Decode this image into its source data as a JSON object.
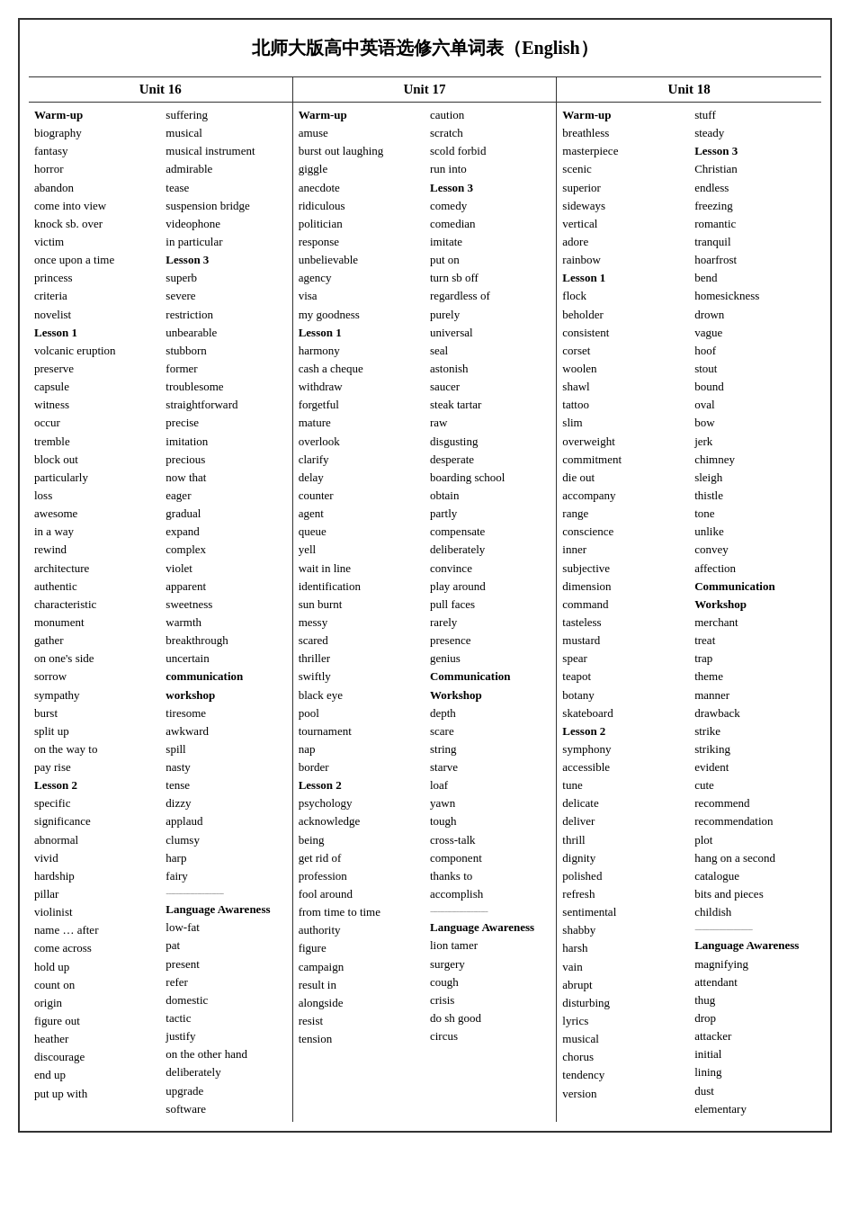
{
  "title": "北师大版高中英语选修六单词表（English）",
  "unit16_header": "Unit 16",
  "unit17_header": "Unit 17",
  "unit18_header": "Unit 18",
  "unit16_col1": [
    {
      "text": "Warm-up",
      "bold": true
    },
    {
      "text": "biography"
    },
    {
      "text": "fantasy"
    },
    {
      "text": "horror"
    },
    {
      "text": "abandon"
    },
    {
      "text": "come into view"
    },
    {
      "text": "knock sb. over"
    },
    {
      "text": "victim"
    },
    {
      "text": "once upon a time"
    },
    {
      "text": "princess"
    },
    {
      "text": "criteria"
    },
    {
      "text": "novelist"
    },
    {
      "text": "Lesson 1",
      "bold": true
    },
    {
      "text": "volcanic eruption"
    },
    {
      "text": "preserve"
    },
    {
      "text": "capsule"
    },
    {
      "text": "witness"
    },
    {
      "text": "occur"
    },
    {
      "text": "tremble"
    },
    {
      "text": "block out"
    },
    {
      "text": "particularly"
    },
    {
      "text": "loss"
    },
    {
      "text": "awesome"
    },
    {
      "text": "in a way"
    },
    {
      "text": "rewind"
    },
    {
      "text": "architecture"
    },
    {
      "text": "authentic"
    },
    {
      "text": "characteristic"
    },
    {
      "text": "monument"
    },
    {
      "text": "gather"
    },
    {
      "text": "on one's side"
    },
    {
      "text": "sorrow"
    },
    {
      "text": "sympathy"
    },
    {
      "text": "burst"
    },
    {
      "text": "split up"
    },
    {
      "text": "on the way to"
    },
    {
      "text": "pay rise"
    },
    {
      "text": "Lesson 2",
      "bold": true
    },
    {
      "text": "specific"
    },
    {
      "text": "significance"
    },
    {
      "text": "abnormal"
    },
    {
      "text": "vivid"
    },
    {
      "text": "hardship"
    },
    {
      "text": "pillar"
    },
    {
      "text": "violinist"
    },
    {
      "text": "name … after"
    },
    {
      "text": "come across"
    },
    {
      "text": "hold up"
    },
    {
      "text": "count on"
    },
    {
      "text": "origin"
    },
    {
      "text": "figure out"
    },
    {
      "text": "heather"
    },
    {
      "text": "discourage"
    },
    {
      "text": "end up"
    },
    {
      "text": "put up with"
    }
  ],
  "unit16_col2": [
    {
      "text": "suffering"
    },
    {
      "text": "musical"
    },
    {
      "text": "musical instrument"
    },
    {
      "text": "admirable"
    },
    {
      "text": "tease"
    },
    {
      "text": "suspension bridge"
    },
    {
      "text": "videophone"
    },
    {
      "text": "in particular"
    },
    {
      "text": "Lesson 3",
      "bold": true
    },
    {
      "text": "superb"
    },
    {
      "text": "severe"
    },
    {
      "text": "restriction"
    },
    {
      "text": "unbearable"
    },
    {
      "text": "stubborn"
    },
    {
      "text": "former"
    },
    {
      "text": "troublesome"
    },
    {
      "text": "straightforward"
    },
    {
      "text": "precise"
    },
    {
      "text": "imitation"
    },
    {
      "text": "precious"
    },
    {
      "text": "now that"
    },
    {
      "text": "eager"
    },
    {
      "text": "gradual"
    },
    {
      "text": "expand"
    },
    {
      "text": "complex"
    },
    {
      "text": "violet"
    },
    {
      "text": "apparent"
    },
    {
      "text": "sweetness"
    },
    {
      "text": "warmth"
    },
    {
      "text": "breakthrough"
    },
    {
      "text": "uncertain"
    },
    {
      "text": "communication",
      "bold": true
    },
    {
      "text": "workshop",
      "bold": true
    },
    {
      "text": "tiresome"
    },
    {
      "text": "awkward"
    },
    {
      "text": "spill"
    },
    {
      "text": "nasty"
    },
    {
      "text": "tense"
    },
    {
      "text": "dizzy"
    },
    {
      "text": "applaud"
    },
    {
      "text": "clumsy"
    },
    {
      "text": "harp"
    },
    {
      "text": "fairy"
    },
    {
      "text": "------------------------",
      "sep": true
    },
    {
      "text": "Language Awareness",
      "bold": true
    },
    {
      "text": "low-fat"
    },
    {
      "text": "pat"
    },
    {
      "text": "present"
    },
    {
      "text": "refer"
    },
    {
      "text": "domestic"
    },
    {
      "text": "tactic"
    },
    {
      "text": "justify"
    },
    {
      "text": "on the other hand"
    },
    {
      "text": "deliberately"
    },
    {
      "text": "upgrade"
    },
    {
      "text": "software"
    }
  ],
  "unit17_col1": [
    {
      "text": "Warm-up",
      "bold": true
    },
    {
      "text": "amuse"
    },
    {
      "text": "burst out laughing"
    },
    {
      "text": "giggle"
    },
    {
      "text": "anecdote"
    },
    {
      "text": "ridiculous"
    },
    {
      "text": "politician"
    },
    {
      "text": "response"
    },
    {
      "text": "unbelievable"
    },
    {
      "text": "agency"
    },
    {
      "text": "visa"
    },
    {
      "text": "my goodness"
    },
    {
      "text": "Lesson 1",
      "bold": true
    },
    {
      "text": "harmony"
    },
    {
      "text": "cash a cheque"
    },
    {
      "text": "withdraw"
    },
    {
      "text": "forgetful"
    },
    {
      "text": "mature"
    },
    {
      "text": "overlook"
    },
    {
      "text": "clarify"
    },
    {
      "text": "delay"
    },
    {
      "text": "counter"
    },
    {
      "text": "agent"
    },
    {
      "text": "queue"
    },
    {
      "text": "yell"
    },
    {
      "text": "wait in line"
    },
    {
      "text": "identification"
    },
    {
      "text": "sun burnt"
    },
    {
      "text": "messy"
    },
    {
      "text": "scared"
    },
    {
      "text": "thriller"
    },
    {
      "text": "swiftly"
    },
    {
      "text": "black eye"
    },
    {
      "text": "pool"
    },
    {
      "text": "tournament"
    },
    {
      "text": "nap"
    },
    {
      "text": "border"
    },
    {
      "text": "Lesson 2",
      "bold": true
    },
    {
      "text": "psychology"
    },
    {
      "text": "acknowledge"
    },
    {
      "text": "being"
    },
    {
      "text": "get rid of"
    },
    {
      "text": "profession"
    },
    {
      "text": "fool around"
    },
    {
      "text": "from time to time"
    },
    {
      "text": "authority"
    },
    {
      "text": "figure"
    },
    {
      "text": "campaign"
    },
    {
      "text": "result in"
    },
    {
      "text": "alongside"
    },
    {
      "text": "resist"
    },
    {
      "text": "tension"
    }
  ],
  "unit17_col2": [
    {
      "text": "caution"
    },
    {
      "text": "scratch"
    },
    {
      "text": "scold forbid"
    },
    {
      "text": "run into"
    },
    {
      "text": "Lesson 3",
      "bold": true
    },
    {
      "text": "comedy"
    },
    {
      "text": "comedian"
    },
    {
      "text": "imitate"
    },
    {
      "text": "put on"
    },
    {
      "text": "turn sb off"
    },
    {
      "text": "regardless of"
    },
    {
      "text": "purely"
    },
    {
      "text": "universal"
    },
    {
      "text": "seal"
    },
    {
      "text": "astonish"
    },
    {
      "text": "saucer"
    },
    {
      "text": "steak tartar"
    },
    {
      "text": "raw"
    },
    {
      "text": "disgusting"
    },
    {
      "text": "desperate"
    },
    {
      "text": "boarding school"
    },
    {
      "text": "obtain"
    },
    {
      "text": "partly"
    },
    {
      "text": "compensate"
    },
    {
      "text": "deliberately"
    },
    {
      "text": "convince"
    },
    {
      "text": "play around"
    },
    {
      "text": "pull faces"
    },
    {
      "text": "rarely"
    },
    {
      "text": "presence"
    },
    {
      "text": "genius"
    },
    {
      "text": "Communication",
      "bold": true
    },
    {
      "text": "Workshop",
      "bold": true
    },
    {
      "text": "depth"
    },
    {
      "text": "scare"
    },
    {
      "text": "string"
    },
    {
      "text": "starve"
    },
    {
      "text": "loaf"
    },
    {
      "text": "yawn"
    },
    {
      "text": "tough"
    },
    {
      "text": "cross-talk"
    },
    {
      "text": "component"
    },
    {
      "text": "thanks to"
    },
    {
      "text": "accomplish"
    },
    {
      "text": "------------------------",
      "sep": true
    },
    {
      "text": "Language Awareness",
      "bold": true
    },
    {
      "text": "lion tamer"
    },
    {
      "text": "surgery"
    },
    {
      "text": "cough"
    },
    {
      "text": "crisis"
    },
    {
      "text": "do sh good"
    },
    {
      "text": "circus"
    }
  ],
  "unit18_col1": [
    {
      "text": "Warm-up",
      "bold": true
    },
    {
      "text": "breathless"
    },
    {
      "text": "masterpiece"
    },
    {
      "text": "scenic"
    },
    {
      "text": "superior"
    },
    {
      "text": "sideways"
    },
    {
      "text": "vertical"
    },
    {
      "text": "adore"
    },
    {
      "text": "rainbow"
    },
    {
      "text": "Lesson 1",
      "bold": true
    },
    {
      "text": "flock"
    },
    {
      "text": "beholder"
    },
    {
      "text": "consistent"
    },
    {
      "text": "corset"
    },
    {
      "text": "woolen"
    },
    {
      "text": "shawl"
    },
    {
      "text": "tattoo"
    },
    {
      "text": "slim"
    },
    {
      "text": "overweight"
    },
    {
      "text": "commitment"
    },
    {
      "text": "die out"
    },
    {
      "text": "accompany"
    },
    {
      "text": "range"
    },
    {
      "text": "conscience"
    },
    {
      "text": "inner"
    },
    {
      "text": "subjective"
    },
    {
      "text": "dimension"
    },
    {
      "text": "command"
    },
    {
      "text": "tasteless"
    },
    {
      "text": "mustard"
    },
    {
      "text": "spear"
    },
    {
      "text": "teapot"
    },
    {
      "text": "botany"
    },
    {
      "text": "skateboard"
    },
    {
      "text": "Lesson 2",
      "bold": true
    },
    {
      "text": "symphony"
    },
    {
      "text": "accessible"
    },
    {
      "text": "tune"
    },
    {
      "text": "delicate"
    },
    {
      "text": "deliver"
    },
    {
      "text": "thrill"
    },
    {
      "text": "dignity"
    },
    {
      "text": "polished"
    },
    {
      "text": "refresh"
    },
    {
      "text": "sentimental"
    },
    {
      "text": "shabby"
    },
    {
      "text": "harsh"
    },
    {
      "text": "vain"
    },
    {
      "text": "abrupt"
    },
    {
      "text": "disturbing"
    },
    {
      "text": "lyrics"
    },
    {
      "text": "musical"
    },
    {
      "text": "chorus"
    },
    {
      "text": "tendency"
    },
    {
      "text": "version"
    }
  ],
  "unit18_col2": [
    {
      "text": "stuff"
    },
    {
      "text": "steady"
    },
    {
      "text": "Lesson 3",
      "bold": true
    },
    {
      "text": "Christian"
    },
    {
      "text": "endless"
    },
    {
      "text": "freezing"
    },
    {
      "text": "romantic"
    },
    {
      "text": "tranquil"
    },
    {
      "text": "hoarfrost"
    },
    {
      "text": "bend"
    },
    {
      "text": "homesickness"
    },
    {
      "text": "drown"
    },
    {
      "text": "vague"
    },
    {
      "text": "hoof"
    },
    {
      "text": "stout"
    },
    {
      "text": "bound"
    },
    {
      "text": "oval"
    },
    {
      "text": "bow"
    },
    {
      "text": "jerk"
    },
    {
      "text": "chimney"
    },
    {
      "text": "sleigh"
    },
    {
      "text": "thistle"
    },
    {
      "text": "tone"
    },
    {
      "text": "unlike"
    },
    {
      "text": "convey"
    },
    {
      "text": "affection"
    },
    {
      "text": "Communication",
      "bold": true
    },
    {
      "text": "Workshop",
      "bold": true
    },
    {
      "text": "merchant"
    },
    {
      "text": "treat"
    },
    {
      "text": "trap"
    },
    {
      "text": "theme"
    },
    {
      "text": "manner"
    },
    {
      "text": "drawback"
    },
    {
      "text": "strike"
    },
    {
      "text": "striking"
    },
    {
      "text": "evident"
    },
    {
      "text": "cute"
    },
    {
      "text": "recommend"
    },
    {
      "text": "recommendation"
    },
    {
      "text": "plot"
    },
    {
      "text": "hang on a second"
    },
    {
      "text": "catalogue"
    },
    {
      "text": "bits and pieces"
    },
    {
      "text": "childish"
    },
    {
      "text": "------------------------",
      "sep": true
    },
    {
      "text": "Language Awareness",
      "bold": true
    },
    {
      "text": "magnifying"
    },
    {
      "text": "attendant"
    },
    {
      "text": "thug"
    },
    {
      "text": "drop"
    },
    {
      "text": "attacker"
    },
    {
      "text": "initial"
    },
    {
      "text": "lining"
    },
    {
      "text": "dust"
    },
    {
      "text": "elementary"
    }
  ]
}
